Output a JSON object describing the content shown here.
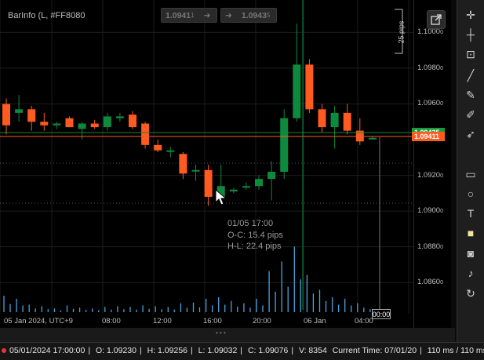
{
  "indicator": {
    "title": "BarInfo (L, #FF8080"
  },
  "quick_buttons": [
    {
      "price": "1.0941",
      "digit": "1"
    },
    {
      "arrow": "➜"
    },
    {
      "arrow": "➜"
    },
    {
      "price": "1.0943",
      "digit": "5"
    }
  ],
  "price_axis": {
    "ticks": [
      {
        "main": "1.1000",
        "sub": "0",
        "value": 1.1
      },
      {
        "main": "1.0980",
        "sub": "0",
        "value": 1.098
      },
      {
        "main": "1.0960",
        "sub": "0",
        "value": 1.096
      },
      {
        "main": "1.0920",
        "sub": "0",
        "value": 1.092
      },
      {
        "main": "1.0900",
        "sub": "0",
        "value": 1.09
      },
      {
        "main": "1.0880",
        "sub": "0",
        "value": 1.088
      },
      {
        "main": "1.0860",
        "sub": "0",
        "value": 1.086
      }
    ],
    "tag_top": {
      "text": "1.09435",
      "color": "#1a9b3a"
    },
    "tag_bottom": {
      "text": "1.09411",
      "color": "#ff5a1f"
    },
    "pips_label": "25 pips"
  },
  "time_axis": {
    "labels": [
      "05 Jan 2024, UTC+9",
      "08:00",
      "12:00",
      "16:00",
      "20:00",
      "06 Jan",
      "04:00"
    ],
    "cursor": "00:00"
  },
  "info_box": {
    "time": "01/05 17:00",
    "oc": "O-C: 15.4 pips",
    "hl": "H-L: 22.4 pips"
  },
  "status_bar": {
    "date": "05/01/2024 17:00:00",
    "open": "O: 1.09230",
    "high": "H: 1.09256",
    "low": "L: 1.09032",
    "close": "C: 1.09076",
    "volume": "V: 8354",
    "current_time": "Current Time:  07/01/20",
    "latency": "110 ms / 110 ms"
  },
  "colors": {
    "bull": "#0e8a3e",
    "bear": "#ff5a1f",
    "volume": "#4aa3df",
    "grid": "#1d1d1d"
  },
  "toolbar": {
    "icons": [
      "crosshair-icon",
      "crosshair-fine-icon",
      "crop-icon",
      "line-icon",
      "pen-icon",
      "brush-icon",
      "arrow-icon",
      "rectangle-icon",
      "circle-icon",
      "text-icon",
      "note-icon",
      "camera-icon",
      "alert-bell-icon",
      "replay-icon"
    ]
  },
  "chart_data": {
    "type": "candlestick",
    "price_scale": {
      "min": 1.085,
      "max": 1.1005
    },
    "candles": [
      {
        "o": 1.096,
        "h": 1.0963,
        "l": 1.0943,
        "c": 1.0948,
        "v": 0.22
      },
      {
        "o": 1.0955,
        "h": 1.0965,
        "l": 1.095,
        "c": 1.0957,
        "v": 0.18
      },
      {
        "o": 1.0957,
        "h": 1.0959,
        "l": 1.0945,
        "c": 1.095,
        "v": 0.1
      },
      {
        "o": 1.095,
        "h": 1.0955,
        "l": 1.0945,
        "c": 1.0948,
        "v": 0.08
      },
      {
        "o": 1.0948,
        "h": 1.095,
        "l": 1.0946,
        "c": 1.0949,
        "v": 0.05
      },
      {
        "o": 1.0952,
        "h": 1.0953,
        "l": 1.0947,
        "c": 1.0947,
        "v": 0.09
      },
      {
        "o": 1.0946,
        "h": 1.095,
        "l": 1.094,
        "c": 1.0949,
        "v": 0.06
      },
      {
        "o": 1.0949,
        "h": 1.0951,
        "l": 1.0946,
        "c": 1.0947,
        "v": 0.05
      },
      {
        "o": 1.0947,
        "h": 1.0955,
        "l": 1.0945,
        "c": 1.0953,
        "v": 0.07
      },
      {
        "o": 1.0952,
        "h": 1.0955,
        "l": 1.095,
        "c": 1.0953,
        "v": 0.08
      },
      {
        "o": 1.0954,
        "h": 1.0956,
        "l": 1.0946,
        "c": 1.0947,
        "v": 0.07
      },
      {
        "o": 1.0949,
        "h": 1.095,
        "l": 1.0935,
        "c": 1.0937,
        "v": 0.09
      },
      {
        "o": 1.0937,
        "h": 1.094,
        "l": 1.0933,
        "c": 1.0934,
        "v": 0.08
      },
      {
        "o": 1.0934,
        "h": 1.0936,
        "l": 1.093,
        "c": 1.0934,
        "v": 0.07
      },
      {
        "o": 1.0932,
        "h": 1.0933,
        "l": 1.0918,
        "c": 1.0921,
        "v": 0.12
      },
      {
        "o": 1.0923,
        "h": 1.0926,
        "l": 1.0917,
        "c": 1.0923,
        "v": 0.13
      },
      {
        "o": 1.0923,
        "h": 1.0926,
        "l": 1.0903,
        "c": 1.0908,
        "v": 0.18
      },
      {
        "o": 1.0908,
        "h": 1.0926,
        "l": 1.0906,
        "c": 1.0914,
        "v": 0.2
      },
      {
        "o": 1.0911,
        "h": 1.0913,
        "l": 1.091,
        "c": 1.0912,
        "v": 0.15
      },
      {
        "o": 1.0914,
        "h": 1.0916,
        "l": 1.0912,
        "c": 1.0914,
        "v": 0.12
      },
      {
        "o": 1.0914,
        "h": 1.092,
        "l": 1.0912,
        "c": 1.0918,
        "v": 0.18
      },
      {
        "o": 1.0918,
        "h": 1.0928,
        "l": 1.0906,
        "c": 1.0922,
        "v": 0.55
      },
      {
        "o": 1.0922,
        "h": 1.0957,
        "l": 1.0918,
        "c": 1.0952,
        "v": 0.68
      },
      {
        "o": 1.0952,
        "h": 1.1005,
        "l": 1.095,
        "c": 1.0982,
        "v": 0.88
      },
      {
        "o": 1.0982,
        "h": 1.0985,
        "l": 1.0955,
        "c": 1.0957,
        "v": 0.5
      },
      {
        "o": 1.0957,
        "h": 1.096,
        "l": 1.0944,
        "c": 1.0947,
        "v": 0.3
      },
      {
        "o": 1.0947,
        "h": 1.0959,
        "l": 1.0935,
        "c": 1.0955,
        "v": 0.2
      },
      {
        "o": 1.0955,
        "h": 1.096,
        "l": 1.0943,
        "c": 1.0945,
        "v": 0.18
      },
      {
        "o": 1.0945,
        "h": 1.0952,
        "l": 1.0937,
        "c": 1.0939,
        "v": 0.12
      },
      {
        "o": 1.0941,
        "h": 1.0942,
        "l": 1.094,
        "c": 1.0941,
        "v": 0.04
      }
    ]
  }
}
